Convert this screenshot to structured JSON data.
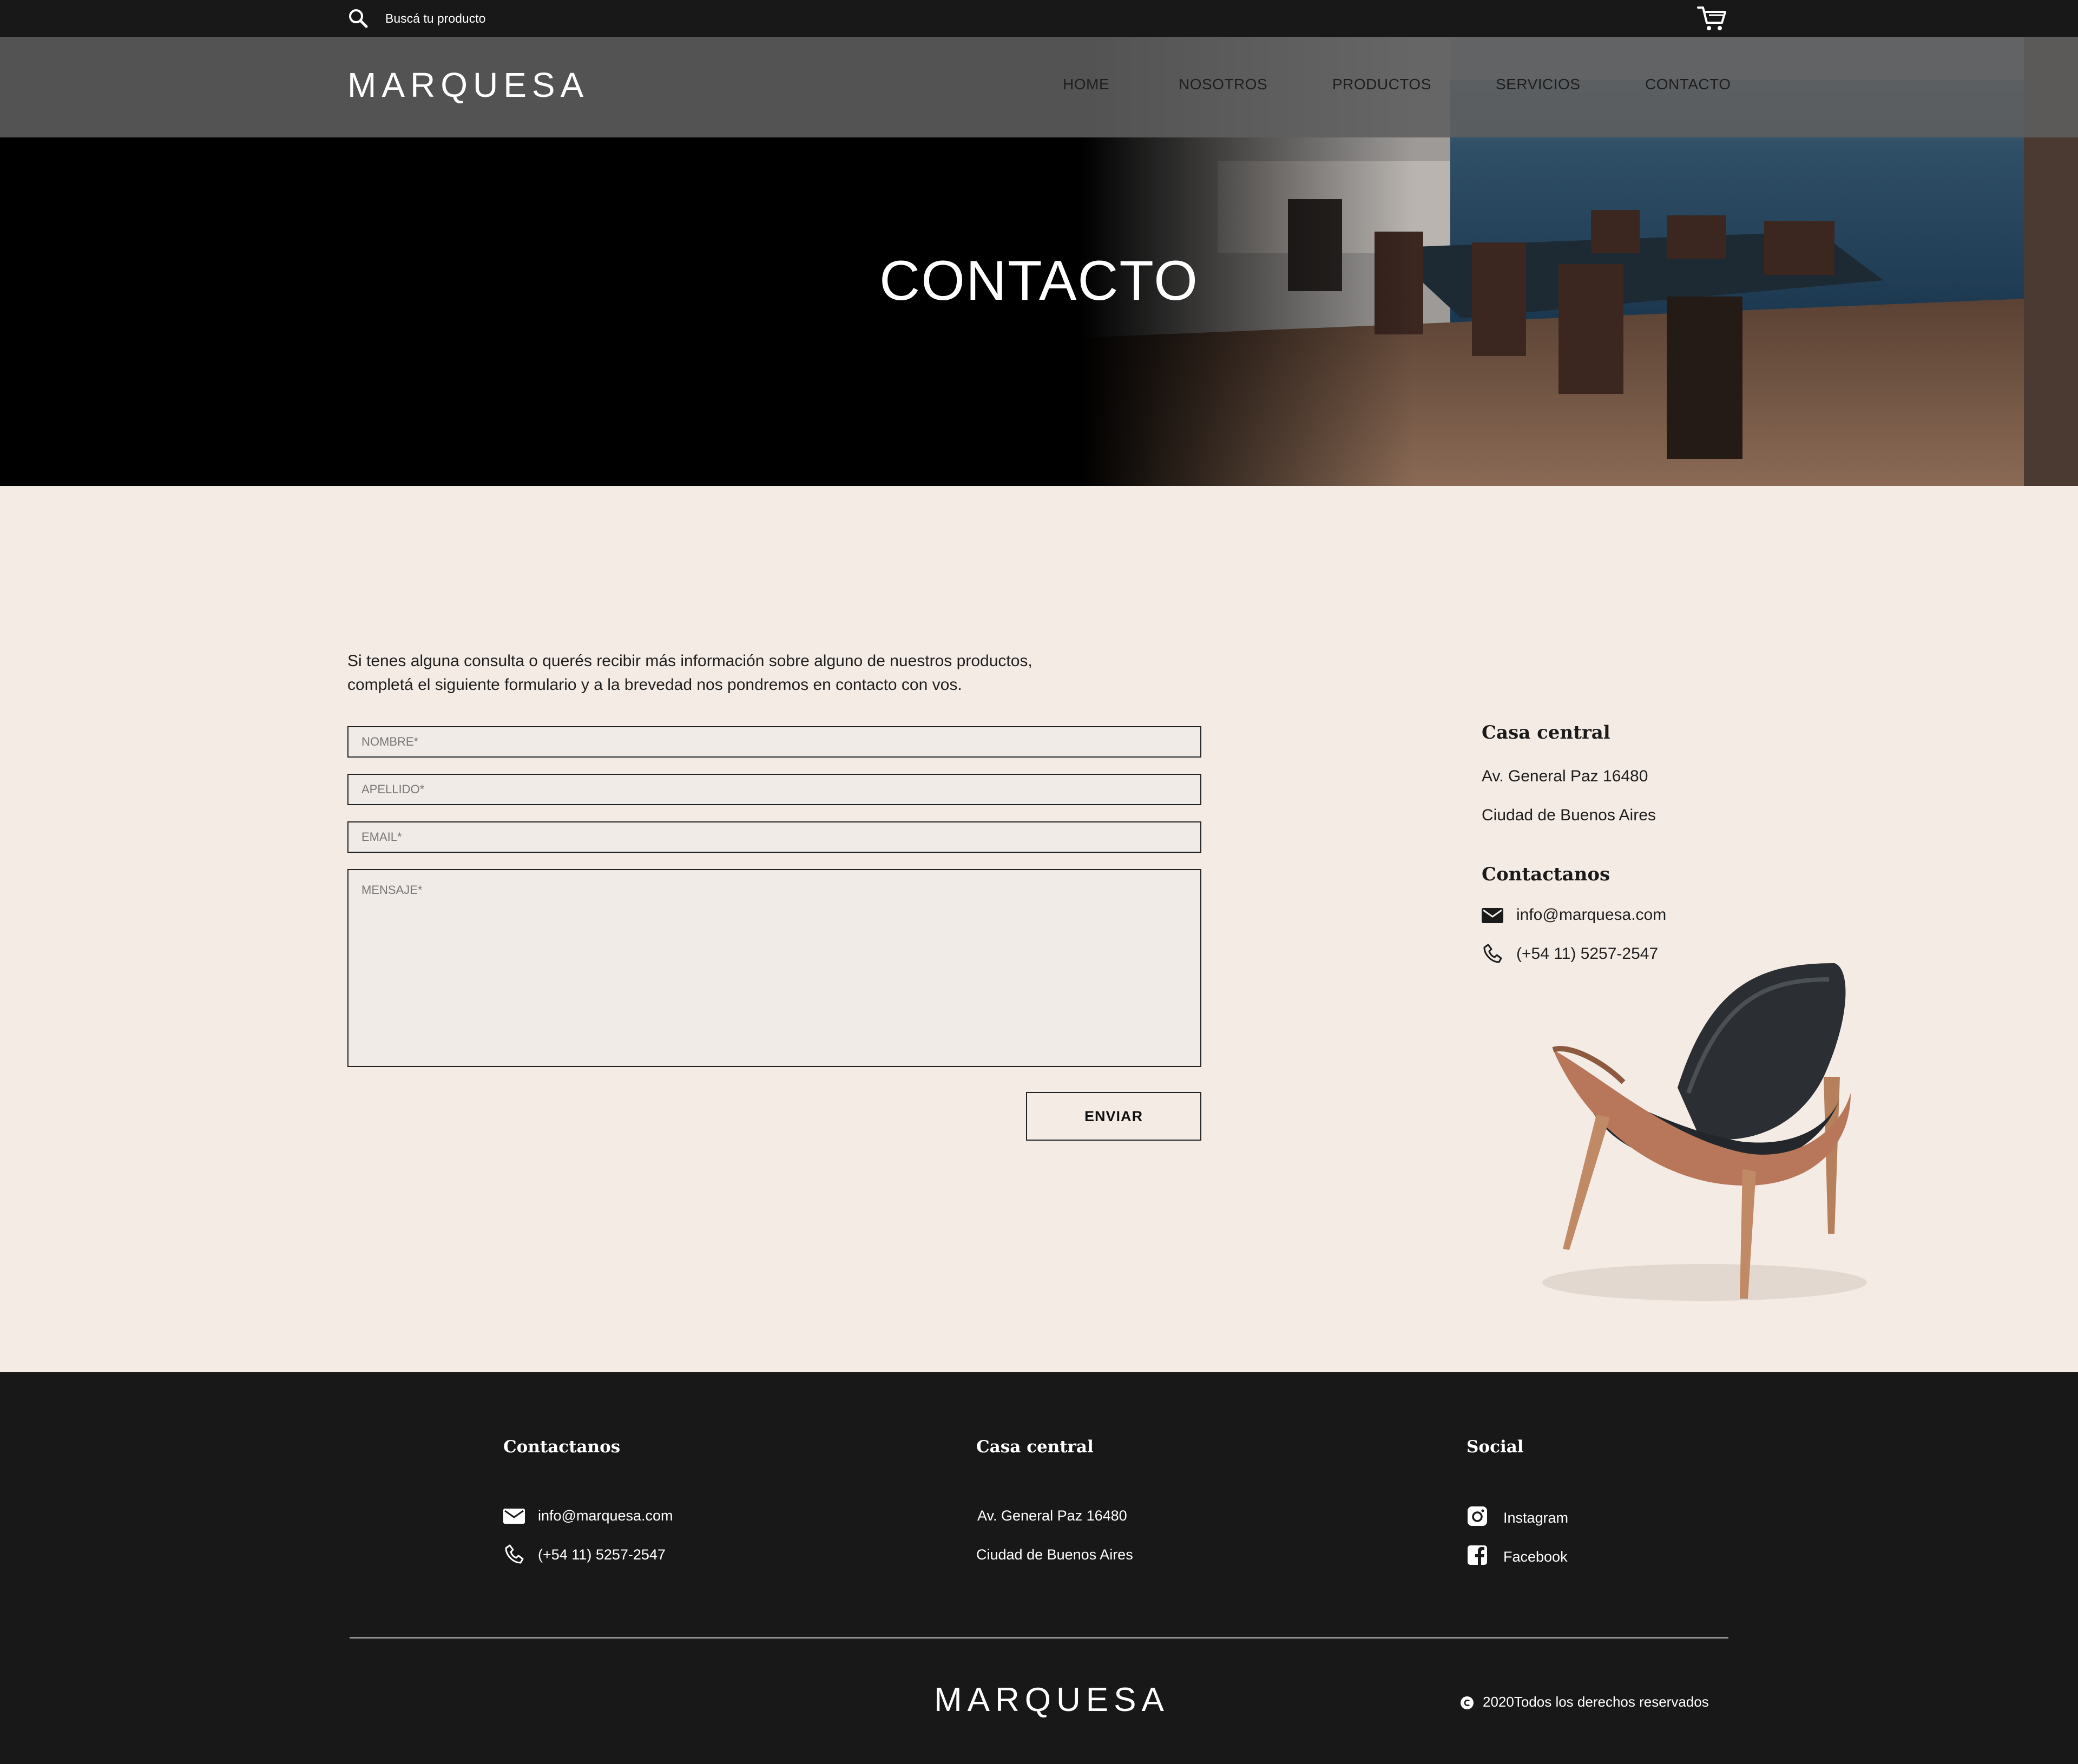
{
  "search": {
    "placeholder": "Buscá tu producto"
  },
  "brand": {
    "name": "MARQUESA"
  },
  "nav": {
    "home": "HOME",
    "nosotros": "NOSOTROS",
    "productos": "PRODUCTOS",
    "servicios": "SERVICIOS",
    "contacto": "CONTACTO"
  },
  "hero": {
    "title": "CONTACTO"
  },
  "form": {
    "intro_line1": "Si tenes alguna consulta o querés recibir más información sobre alguno de nuestros productos,",
    "intro_line2": "completá el siguiente formulario y a la brevedad nos pondremos en contacto con vos.",
    "nombre_placeholder": "NOMBRE*",
    "apellido_placeholder": "APELLIDO*",
    "email_placeholder": "EMAIL*",
    "mensaje_placeholder": "MENSAJE*",
    "submit_label": "ENVIAR"
  },
  "sidebar": {
    "casa_heading": "Casa central",
    "address_line1": "Av. General Paz 16480",
    "address_line2": "Ciudad de Buenos Aires",
    "contact_heading": "Contactanos",
    "email": "info@marquesa.com",
    "phone": "(+54 11) 5257-2547"
  },
  "footer": {
    "contact_heading": "Contactanos",
    "email": "info@marquesa.com",
    "phone": "(+54 11) 5257-2547",
    "casa_heading": "Casa central",
    "address_line1": "Av. General Paz 16480",
    "address_line2": "Ciudad de Buenos Aires",
    "social_heading": "Social",
    "instagram": "Instagram",
    "facebook": "Facebook",
    "copyright": "2020Todos los derechos reservados"
  },
  "icons": {
    "search": "search-icon",
    "cart": "cart-icon",
    "mail": "mail-icon",
    "phone": "phone-icon",
    "instagram": "instagram-icon",
    "facebook": "facebook-icon",
    "copyright": "copyright-icon"
  },
  "colors": {
    "topbar": "#181818",
    "navbar": "#5f5f5f",
    "page_bg": "#f4ebe5",
    "footer_bg": "#181818",
    "accent": "#c0392b"
  }
}
